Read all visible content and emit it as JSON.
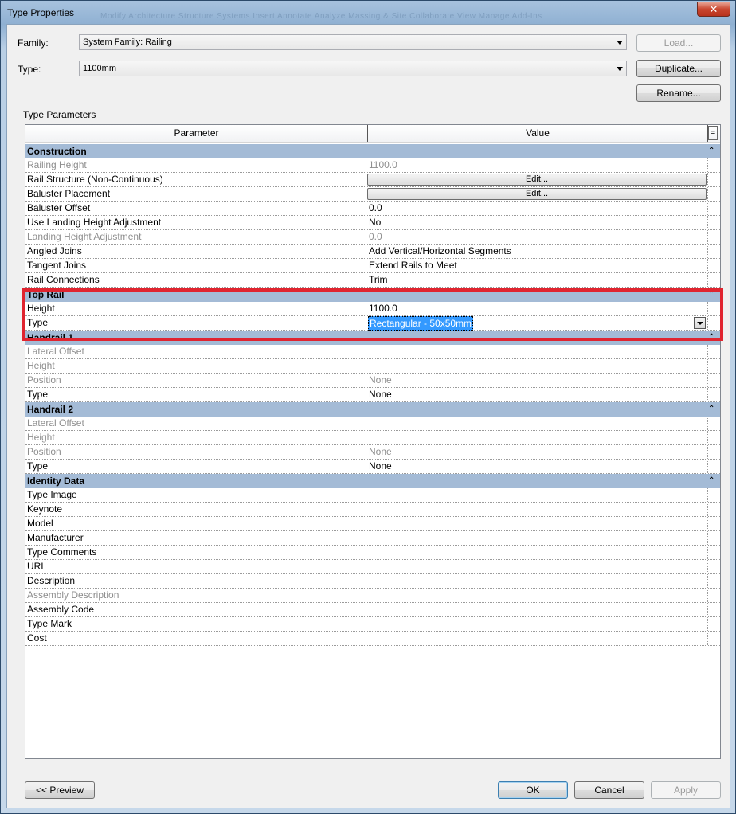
{
  "window": {
    "title": "Type Properties",
    "close_glyph": "✕",
    "ghost_menu": "Modify   Architecture   Structure   Systems   Insert   Annotate   Analyze   Massing & Site   Collaborate   View   Manage   Add-Ins"
  },
  "family": {
    "label": "Family:",
    "value": "System Family: Railing"
  },
  "type": {
    "label": "Type:",
    "value": "1100mm"
  },
  "buttons": {
    "load": "Load...",
    "duplicate": "Duplicate...",
    "rename": "Rename...",
    "preview": "<< Preview",
    "ok": "OK",
    "cancel": "Cancel",
    "apply": "Apply"
  },
  "section_label": "Type Parameters",
  "columns": {
    "parameter": "Parameter",
    "value": "Value",
    "eq": "="
  },
  "groups": [
    {
      "name": "Construction",
      "rows": [
        {
          "param": "Railing Height",
          "value": "1100.0",
          "gray": true
        },
        {
          "param": "Rail Structure (Non-Continuous)",
          "value": "Edit...",
          "button": true
        },
        {
          "param": "Baluster Placement",
          "value": "Edit...",
          "button": true
        },
        {
          "param": "Baluster Offset",
          "value": "0.0"
        },
        {
          "param": "Use Landing Height Adjustment",
          "value": "No"
        },
        {
          "param": "Landing Height Adjustment",
          "value": "0.0",
          "gray": true
        },
        {
          "param": "Angled Joins",
          "value": "Add Vertical/Horizontal Segments"
        },
        {
          "param": "Tangent Joins",
          "value": "Extend Rails to Meet"
        },
        {
          "param": "Rail Connections",
          "value": "Trim"
        }
      ]
    },
    {
      "name": "Top Rail",
      "rows": [
        {
          "param": "Height",
          "value": "1100.0"
        },
        {
          "param": "Type",
          "value": "Rectangular - 50x50mm",
          "selected": true
        }
      ]
    },
    {
      "name": "Handrail 1",
      "rows": [
        {
          "param": "Lateral Offset",
          "value": "",
          "gray": true
        },
        {
          "param": "Height",
          "value": "",
          "gray": true
        },
        {
          "param": "Position",
          "value": "None",
          "gray": true
        },
        {
          "param": "Type",
          "value": "None"
        }
      ]
    },
    {
      "name": "Handrail 2",
      "rows": [
        {
          "param": "Lateral Offset",
          "value": "",
          "gray": true
        },
        {
          "param": "Height",
          "value": "",
          "gray": true
        },
        {
          "param": "Position",
          "value": "None",
          "gray": true
        },
        {
          "param": "Type",
          "value": "None"
        }
      ]
    },
    {
      "name": "Identity Data",
      "rows": [
        {
          "param": "Type Image",
          "value": ""
        },
        {
          "param": "Keynote",
          "value": ""
        },
        {
          "param": "Model",
          "value": ""
        },
        {
          "param": "Manufacturer",
          "value": ""
        },
        {
          "param": "Type Comments",
          "value": ""
        },
        {
          "param": "URL",
          "value": ""
        },
        {
          "param": "Description",
          "value": ""
        },
        {
          "param": "Assembly Description",
          "value": "",
          "gray": true
        },
        {
          "param": "Assembly Code",
          "value": ""
        },
        {
          "param": "Type Mark",
          "value": ""
        },
        {
          "param": "Cost",
          "value": ""
        }
      ]
    }
  ]
}
